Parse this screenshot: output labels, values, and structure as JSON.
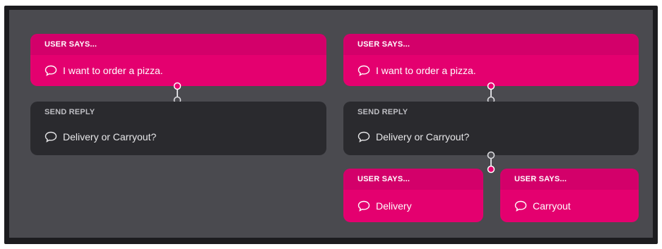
{
  "left_flow": {
    "user_card": {
      "header": "USER SAYS...",
      "message": "I want to order a pizza."
    },
    "reply_card": {
      "header": "SEND REPLY",
      "message": "Delivery or Carryout?"
    }
  },
  "right_flow": {
    "user_card": {
      "header": "USER SAYS...",
      "message": "I want to order a pizza."
    },
    "reply_card": {
      "header": "SEND REPLY",
      "message": "Delivery or Carryout?"
    },
    "branch_delivery": {
      "header": "USER SAYS...",
      "message": "Delivery"
    },
    "branch_carryout": {
      "header": "USER SAYS...",
      "message": "Carryout"
    }
  },
  "colors": {
    "accent": "#e4006f",
    "reply_card": "#2a2a2e",
    "canvas": "#4a4a4f",
    "frame": "#1c1c1f"
  },
  "icons": {
    "message": "speech-bubble-icon"
  }
}
